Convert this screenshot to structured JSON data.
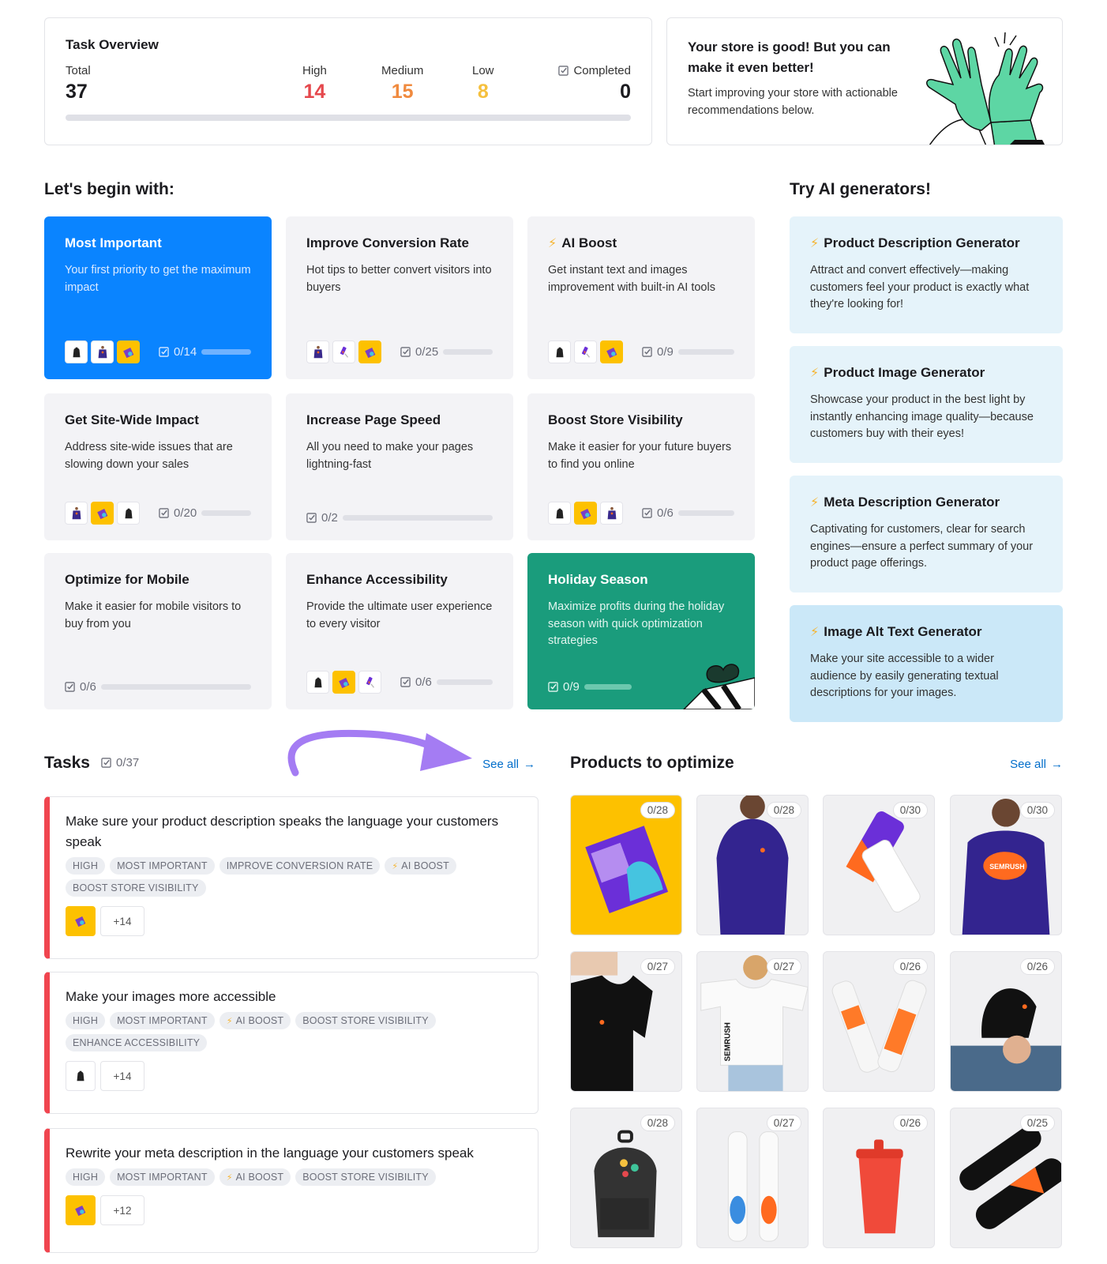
{
  "overview": {
    "title": "Task Overview",
    "total_label": "Total",
    "total": "37",
    "high_label": "High",
    "high": "14",
    "medium_label": "Medium",
    "medium": "15",
    "low_label": "Low",
    "low": "8",
    "completed_label": "Completed",
    "completed": "0",
    "progress_fraction": 0,
    "colors": {
      "high": "#e5484d",
      "medium": "#f08a3e",
      "low": "#f5c03e"
    }
  },
  "promo": {
    "title": "Your store is good! But you can make it even better!",
    "text": "Start improving your store with actionable recommendations below."
  },
  "begin": {
    "title": "Let's begin with:",
    "cards": [
      {
        "title": "Most Important",
        "desc": "Your first priority to get the maximum impact",
        "progress": "0/14",
        "thumbs": [
          "backpack",
          "sweatshirt",
          "book"
        ],
        "style": "blue"
      },
      {
        "title": "Improve Conversion Rate",
        "desc": "Hot tips to better convert visitors into buyers",
        "progress": "0/25",
        "thumbs": [
          "sweatshirt",
          "gift-card",
          "book"
        ],
        "style": "default"
      },
      {
        "title": "AI Boost",
        "desc": "Get instant text and images improvement with built-in AI tools",
        "progress": "0/9",
        "thumbs": [
          "backpack",
          "gift-card",
          "book"
        ],
        "style": "default",
        "bolt": true
      },
      {
        "title": "Get Site-Wide Impact",
        "desc": "Address site-wide issues that are slowing down your sales",
        "progress": "0/20",
        "thumbs": [
          "sweatshirt",
          "book",
          "backpack"
        ],
        "style": "default"
      },
      {
        "title": "Increase Page Speed",
        "desc": "All you need to make your pages lightning-fast",
        "progress": "0/2",
        "thumbs": [],
        "style": "default"
      },
      {
        "title": "Boost Store Visibility",
        "desc": "Make it easier for your future buyers to find you online",
        "progress": "0/6",
        "thumbs": [
          "backpack",
          "book",
          "sweatshirt"
        ],
        "style": "default"
      },
      {
        "title": "Optimize for Mobile",
        "desc": "Make it easier for mobile visitors to buy from you",
        "progress": "0/6",
        "thumbs": [],
        "style": "default"
      },
      {
        "title": "Enhance Accessibility",
        "desc": "Provide the ultimate user experience to every visitor",
        "progress": "0/6",
        "thumbs": [
          "backpack",
          "book",
          "gift-card"
        ],
        "style": "default"
      },
      {
        "title": "Holiday Season",
        "desc": "Maximize profits during the holiday season with quick optimization strategies",
        "progress": "0/9",
        "thumbs": [],
        "style": "green"
      }
    ]
  },
  "ai": {
    "title": "Try AI generators!",
    "generators": [
      {
        "title": "Product Description Generator",
        "desc": "Attract and convert effectively—making customers feel your product is exactly what they're looking for!"
      },
      {
        "title": "Product Image Generator",
        "desc": "Showcase your product in the best light by instantly enhancing image quality—because customers buy with their eyes!"
      },
      {
        "title": "Meta Description Generator",
        "desc": "Captivating for customers, clear for search engines—ensure a perfect summary of your product page offerings."
      },
      {
        "title": "Image Alt Text Generator",
        "desc": "Make your site accessible to a wider audience by easily generating textual descriptions for your images."
      }
    ]
  },
  "tasks": {
    "title": "Tasks",
    "count": "0/37",
    "see_all": "See all",
    "items": [
      {
        "title": "Make sure your product description speaks the language your customers speak",
        "tags": [
          "HIGH",
          "MOST IMPORTANT",
          "IMPROVE CONVERSION RATE",
          "AI BOOST",
          "BOOST STORE VISIBILITY"
        ],
        "thumb": "book",
        "more": "+14"
      },
      {
        "title": "Make your images more accessible",
        "tags": [
          "HIGH",
          "MOST IMPORTANT",
          "AI BOOST",
          "BOOST STORE VISIBILITY",
          "ENHANCE ACCESSIBILITY"
        ],
        "thumb": "backpack",
        "more": "+14"
      },
      {
        "title": "Rewrite your meta description in the language your customers speak",
        "tags": [
          "HIGH",
          "MOST IMPORTANT",
          "AI BOOST",
          "BOOST STORE VISIBILITY"
        ],
        "thumb": "book",
        "more": "+12"
      }
    ]
  },
  "products": {
    "title": "Products to optimize",
    "see_all": "See all",
    "items": [
      {
        "name": "book",
        "progress": "0/28"
      },
      {
        "name": "hoodie",
        "progress": "0/28"
      },
      {
        "name": "gift-card",
        "progress": "0/30"
      },
      {
        "name": "sweatshirt",
        "progress": "0/30"
      },
      {
        "name": "black-tshirt",
        "progress": "0/27"
      },
      {
        "name": "white-tshirt",
        "progress": "0/27"
      },
      {
        "name": "clear-bottles",
        "progress": "0/26"
      },
      {
        "name": "black-cap",
        "progress": "0/26"
      },
      {
        "name": "backpack",
        "progress": "0/28"
      },
      {
        "name": "white-bottles",
        "progress": "0/27"
      },
      {
        "name": "red-cup",
        "progress": "0/26"
      },
      {
        "name": "black-bottles",
        "progress": "0/25"
      }
    ]
  }
}
